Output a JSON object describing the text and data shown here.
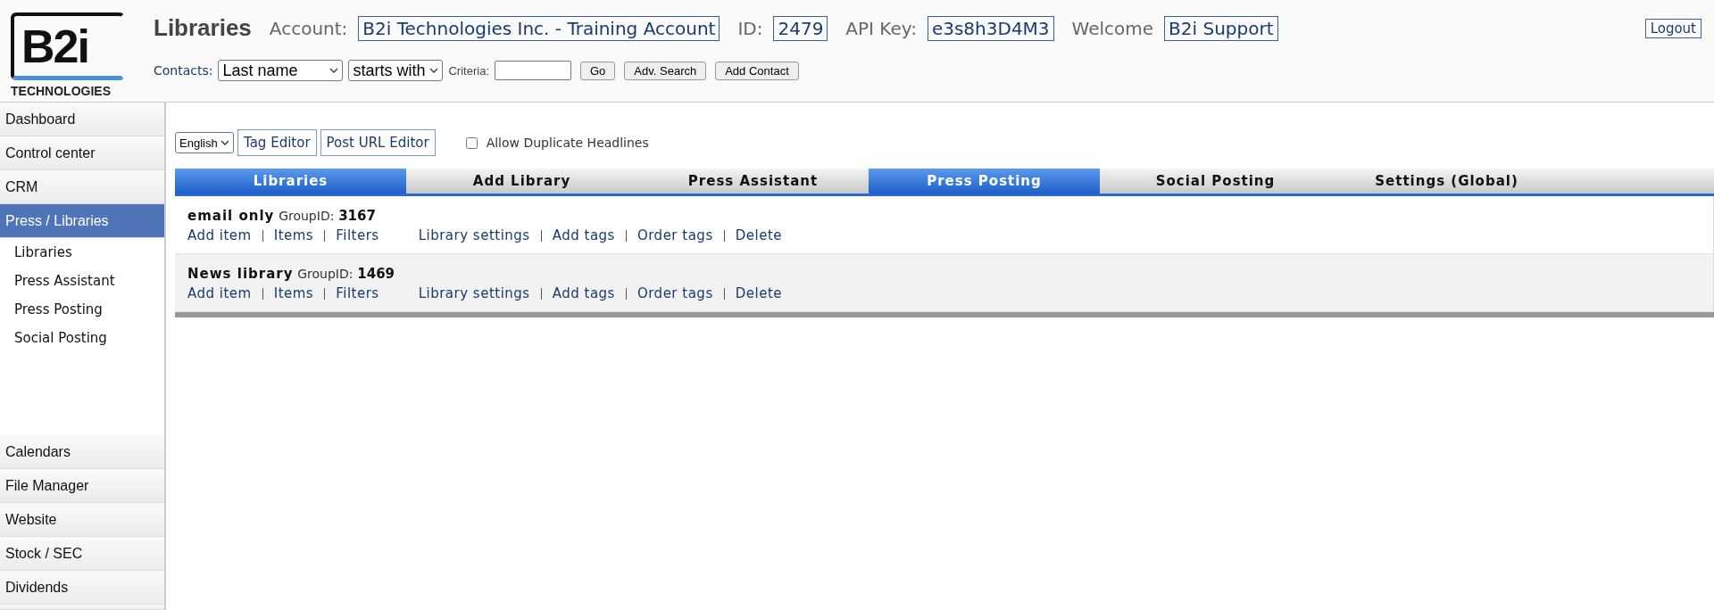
{
  "logo": {
    "mark": "B2i",
    "caption": "TECHNOLOGIES"
  },
  "header": {
    "title": "Libraries",
    "fields": [
      {
        "label": "Account:",
        "value": "B2i Technologies Inc. - Training Account"
      },
      {
        "label": "ID:",
        "value": "2479"
      },
      {
        "label": "API Key:",
        "value": "e3s8h3D4M3"
      },
      {
        "label": "Welcome",
        "value": "B2i Support"
      }
    ],
    "logout": "Logout"
  },
  "contacts": {
    "label": "Contacts:",
    "field": "Last name",
    "match": "starts with",
    "criteria_label": "Criteria:",
    "buttons": [
      "Go",
      "Adv. Search",
      "Add Contact"
    ]
  },
  "sidebar": {
    "items": [
      {
        "label": "Dashboard",
        "selected": false
      },
      {
        "label": "Control center",
        "selected": false
      },
      {
        "label": "CRM",
        "selected": false
      },
      {
        "label": "Press / Libraries",
        "selected": true,
        "children": [
          {
            "label": "Libraries"
          },
          {
            "label": "Press Assistant"
          },
          {
            "label": "Press Posting"
          },
          {
            "label": "Social Posting"
          }
        ]
      }
    ],
    "bottom_items": [
      {
        "label": "Calendars"
      },
      {
        "label": "File Manager"
      },
      {
        "label": "Website"
      },
      {
        "label": "Stock / SEC"
      },
      {
        "label": "Dividends"
      }
    ]
  },
  "toolbar": {
    "language": "English",
    "buttons": [
      "Tag Editor",
      "Post URL Editor"
    ],
    "checkbox": {
      "label": "Allow Duplicate Headlines",
      "checked": false
    }
  },
  "tabs": [
    {
      "label": "Libraries",
      "selected": true
    },
    {
      "label": "Add Library",
      "selected": false
    },
    {
      "label": "Press Assistant",
      "selected": false
    },
    {
      "label": "Press Posting",
      "selected": true
    },
    {
      "label": "Social Posting",
      "selected": false
    },
    {
      "label": "Settings (Global)",
      "selected": false
    }
  ],
  "libraries": [
    {
      "name": "email only",
      "group_label": "GroupID:",
      "group_id": "3167",
      "links": [
        "Add item",
        "Items",
        "Filters"
      ],
      "links_2": [
        "Library settings",
        "Add tags",
        "Order tags",
        "Delete"
      ]
    },
    {
      "name": "News library",
      "group_label": "GroupID:",
      "group_id": "1469",
      "links": [
        "Add item",
        "Items",
        "Filters"
      ],
      "links_2": [
        "Library settings",
        "Add tags",
        "Order tags",
        "Delete"
      ]
    }
  ]
}
